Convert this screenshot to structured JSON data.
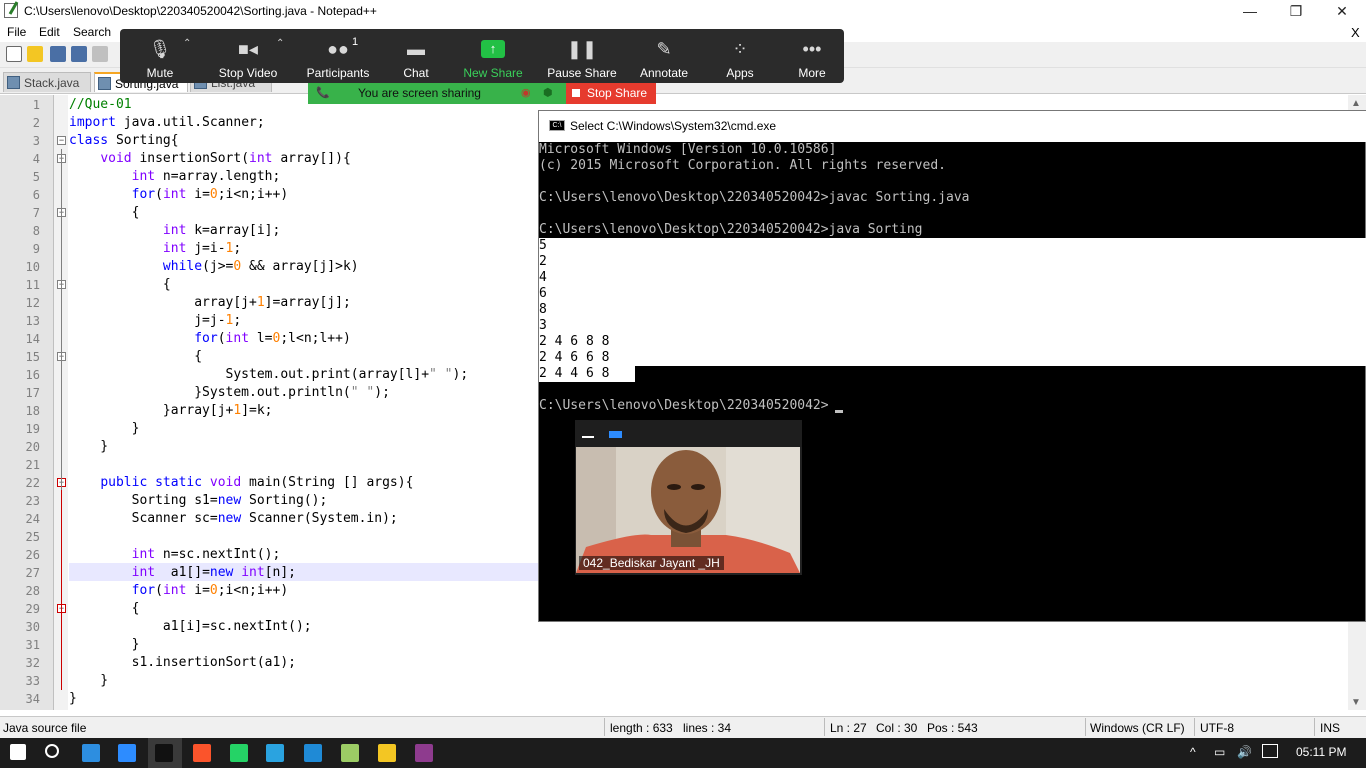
{
  "window": {
    "title": "C:\\Users\\lenovo\\Desktop\\220340520042\\Sorting.java - Notepad++",
    "controls": [
      "—",
      "❐",
      "✕"
    ],
    "close_doc": "X"
  },
  "menu": [
    "File",
    "Edit",
    "Search"
  ],
  "tabs": [
    {
      "label": "Stack.java",
      "active": false
    },
    {
      "label": "Sorting.java",
      "active": true
    },
    {
      "label": "List.java",
      "active": false
    }
  ],
  "zoom": {
    "buttons": [
      {
        "label": "Mute",
        "icon": "microphone-icon"
      },
      {
        "label": "Stop Video",
        "icon": "video-camera-icon"
      },
      {
        "label": "Participants",
        "icon": "participants-icon",
        "count": "1"
      },
      {
        "label": "Chat",
        "icon": "chat-icon"
      },
      {
        "label": "New Share",
        "icon": "share-arrow-icon"
      },
      {
        "label": "Pause Share",
        "icon": "pause-icon"
      },
      {
        "label": "Annotate",
        "icon": "pen-icon"
      },
      {
        "label": "Apps",
        "icon": "apps-icon"
      },
      {
        "label": "More",
        "icon": "more-dots-icon"
      }
    ],
    "sharing_text": "You are screen sharing",
    "stop_share": "Stop Share"
  },
  "editor": {
    "lines": [
      {
        "n": "1",
        "html": "<span class='cm'>//Que-01</span>"
      },
      {
        "n": "2",
        "html": "<span class='kw'>import</span> java.util.Scanner;"
      },
      {
        "n": "3",
        "html": "<span class='kw'>class</span> Sorting{"
      },
      {
        "n": "4",
        "html": "    <span class='ty'>void</span> insertionSort(<span class='ty'>int</span> array[]){"
      },
      {
        "n": "5",
        "html": "        <span class='ty'>int</span> n=array.length;"
      },
      {
        "n": "6",
        "html": "        <span class='kw'>for</span>(<span class='ty'>int</span> i=<span class='num'>0</span>;i&lt;n;i++)"
      },
      {
        "n": "7",
        "html": "        {"
      },
      {
        "n": "8",
        "html": "            <span class='ty'>int</span> k=array[i];"
      },
      {
        "n": "9",
        "html": "            <span class='ty'>int</span> j=i-<span class='num'>1</span>;"
      },
      {
        "n": "10",
        "html": "            <span class='kw'>while</span>(j&gt;=<span class='num'>0</span> &amp;&amp; array[j]&gt;k)"
      },
      {
        "n": "11",
        "html": "            {"
      },
      {
        "n": "12",
        "html": "                array[j+<span class='num'>1</span>]=array[j];"
      },
      {
        "n": "13",
        "html": "                j=j-<span class='num'>1</span>;"
      },
      {
        "n": "14",
        "html": "                <span class='kw'>for</span>(<span class='ty'>int</span> l=<span class='num'>0</span>;l&lt;n;l++)"
      },
      {
        "n": "15",
        "html": "                {"
      },
      {
        "n": "16",
        "html": "                    System.out.print(array[l]+<span class='str'>\" \"</span>);"
      },
      {
        "n": "17",
        "html": "                }System.out.println(<span class='str'>\" \"</span>);"
      },
      {
        "n": "18",
        "html": "            }array[j+<span class='num'>1</span>]=k;"
      },
      {
        "n": "19",
        "html": "        }"
      },
      {
        "n": "20",
        "html": "    }"
      },
      {
        "n": "21",
        "html": ""
      },
      {
        "n": "22",
        "html": "    <span class='kw'>public</span> <span class='kw'>static</span> <span class='ty'>void</span> main(String [] args){"
      },
      {
        "n": "23",
        "html": "        Sorting s1=<span class='kw'>new</span> Sorting();"
      },
      {
        "n": "24",
        "html": "        Scanner sc=<span class='kw'>new</span> Scanner(System.in);"
      },
      {
        "n": "25",
        "html": ""
      },
      {
        "n": "26",
        "html": "        <span class='ty'>int</span> n=sc.nextInt();"
      },
      {
        "n": "27",
        "html": "        <span class='ty'>int</span>  a1[]=<span class='kw'>new</span> <span class='ty'>int</span>[n];"
      },
      {
        "n": "28",
        "html": "        <span class='kw'>for</span>(<span class='ty'>int</span> i=<span class='num'>0</span>;i&lt;n;i++)"
      },
      {
        "n": "29",
        "html": "        {"
      },
      {
        "n": "30",
        "html": "            a1[i]=sc.nextInt();"
      },
      {
        "n": "31",
        "html": "        }"
      },
      {
        "n": "32",
        "html": "        s1.insertionSort(a1);"
      },
      {
        "n": "33",
        "html": "    }"
      },
      {
        "n": "34",
        "html": "}"
      }
    ]
  },
  "cmd": {
    "title": "Select C:\\Windows\\System32\\cmd.exe",
    "lines": [
      "Microsoft Windows [Version 10.0.10586]",
      "(c) 2015 Microsoft Corporation. All rights reserved.",
      "",
      "C:\\Users\\lenovo\\Desktop\\220340520042>javac Sorting.java",
      "",
      "C:\\Users\\lenovo\\Desktop\\220340520042>java Sorting",
      "5",
      "2",
      "4",
      "6",
      "8",
      "3",
      "2 4 6 8 8",
      "2 4 6 6 8",
      "2 4 4 6 8",
      "",
      "C:\\Users\\lenovo\\Desktop\\220340520042>"
    ]
  },
  "video": {
    "name": "042_Bediskar Jayant _JH"
  },
  "status": {
    "filetype": "Java source file",
    "length": "length : 633",
    "lines": "lines : 34",
    "ln": "Ln : 27",
    "col": "Col : 30",
    "pos": "Pos : 543",
    "eol": "Windows (CR LF)",
    "encoding": "UTF-8",
    "mode": "INS"
  },
  "taskbar": {
    "time": "05:11 PM",
    "icons": [
      "windows-start-icon",
      "search-icon",
      "vscode-icon",
      "zoom-icon",
      "cmd-icon",
      "brave-icon",
      "whatsapp-icon",
      "telegram-icon",
      "edge-icon",
      "notepad-plus-plus-icon",
      "file-explorer-icon",
      "winrar-icon"
    ],
    "icon_colors": [
      "#ffffff",
      "#ffffff",
      "#2d8ee0",
      "#2d8cff",
      "#111111",
      "#fb542b",
      "#25d366",
      "#2aa3e0",
      "#1f8ad6",
      "#9ccc65",
      "#f3c623",
      "#8e3b8e"
    ]
  }
}
